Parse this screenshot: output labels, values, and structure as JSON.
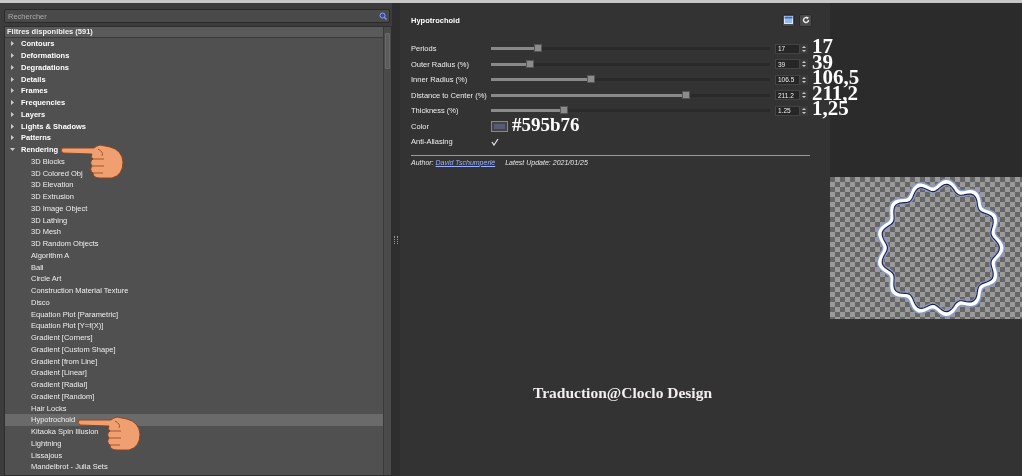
{
  "search": {
    "placeholder": "Rechercher"
  },
  "filters": {
    "header": "Filtres disponibles (591)",
    "categories": [
      {
        "label": "Contours",
        "expanded": false
      },
      {
        "label": "Deformations",
        "expanded": false
      },
      {
        "label": "Degradations",
        "expanded": false
      },
      {
        "label": "Details",
        "expanded": false
      },
      {
        "label": "Frames",
        "expanded": false
      },
      {
        "label": "Frequencies",
        "expanded": false
      },
      {
        "label": "Layers",
        "expanded": false
      },
      {
        "label": "Lights & Shadows",
        "expanded": false
      },
      {
        "label": "Patterns",
        "expanded": false
      },
      {
        "label": "Rendering",
        "expanded": true,
        "pointed": true,
        "children": [
          {
            "label": "3D Blocks",
            "selected": false
          },
          {
            "label": "3D Colored Obj",
            "selected": false
          },
          {
            "label": "3D Elevation",
            "selected": false
          },
          {
            "label": "3D Extrusion",
            "selected": false
          },
          {
            "label": "3D Image Object",
            "selected": false
          },
          {
            "label": "3D Lathing",
            "selected": false
          },
          {
            "label": "3D Mesh",
            "selected": false
          },
          {
            "label": "3D Random Objects",
            "selected": false
          },
          {
            "label": "Algorithm A",
            "selected": false
          },
          {
            "label": "Ball",
            "selected": false
          },
          {
            "label": "Circle Art",
            "selected": false
          },
          {
            "label": "Construction Material Texture",
            "selected": false
          },
          {
            "label": "Disco",
            "selected": false
          },
          {
            "label": "Equation Plot [Parametric]",
            "selected": false
          },
          {
            "label": "Equation Plot [Y=f(X)]",
            "selected": false
          },
          {
            "label": "Gradient [Corners]",
            "selected": false
          },
          {
            "label": "Gradient [Custom Shape]",
            "selected": false
          },
          {
            "label": "Gradient [from Line]",
            "selected": false
          },
          {
            "label": "Gradient [Linear]",
            "selected": false
          },
          {
            "label": "Gradient [Radial]",
            "selected": false
          },
          {
            "label": "Gradient [Random]",
            "selected": false
          },
          {
            "label": "Hair Locks",
            "selected": false
          },
          {
            "label": "Hypotrochoid",
            "selected": true,
            "pointed": true
          },
          {
            "label": "Kitaoka Spin Illusion",
            "selected": false
          },
          {
            "label": "Lightning",
            "selected": false
          },
          {
            "label": "Lissajous",
            "selected": false
          },
          {
            "label": "Mandelbrot - Julia Sets",
            "selected": false
          }
        ]
      }
    ]
  },
  "filter_panel": {
    "title": "Hypotrochoid",
    "params": [
      {
        "kind": "slider",
        "label": "Periods",
        "level": 0.17,
        "value": "17",
        "annotation": "17"
      },
      {
        "kind": "slider",
        "label": "Outer Radius (%)",
        "level": 0.14,
        "value": "39",
        "annotation": "39"
      },
      {
        "kind": "slider",
        "label": "Inner Radius (%)",
        "level": 0.36,
        "value": "106.5",
        "annotation": "106,5"
      },
      {
        "kind": "slider",
        "label": "Distance to Center (%)",
        "level": 0.7,
        "value": "211.2",
        "annotation": "211,2"
      },
      {
        "kind": "slider",
        "label": "Thickness (%)",
        "level": 0.26,
        "value": "1.25",
        "annotation": "1,25"
      },
      {
        "kind": "color",
        "label": "Color",
        "color": "#595b76",
        "annotation": "#595b76"
      },
      {
        "kind": "checkbox",
        "label": "Anti-Aliasing",
        "checked": true
      }
    ],
    "author_label": "Author:",
    "author": "David Tschumperlé",
    "update_label": "Latest Update:",
    "update_date": "2021/01/25"
  },
  "credit": "Traduction@Cloclo Design"
}
